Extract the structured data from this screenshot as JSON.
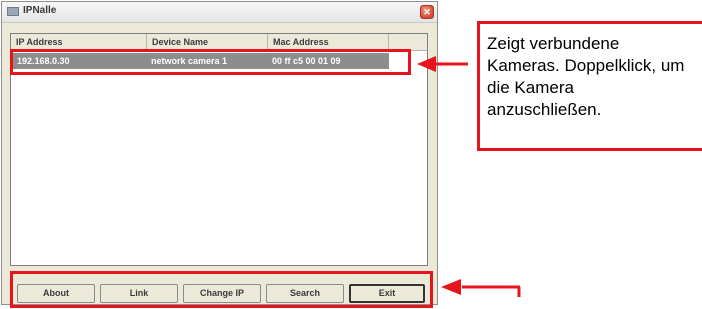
{
  "window": {
    "title": "IPNalle"
  },
  "list": {
    "columns": [
      "IP Address",
      "Device Name",
      "Mac Address"
    ],
    "rows": [
      {
        "ip": "192.168.0.30",
        "device_name": "network camera 1",
        "mac": "00 ff c5 00 01 09"
      }
    ]
  },
  "buttons": {
    "about": "About",
    "link": "Link",
    "change_ip": "Change IP",
    "search": "Search",
    "exit": "Exit"
  },
  "annotation": {
    "text": "Zeigt verbundene Kameras. Doppelklick, um die Kamera anzuschließen.",
    "color": "#e8141c"
  }
}
